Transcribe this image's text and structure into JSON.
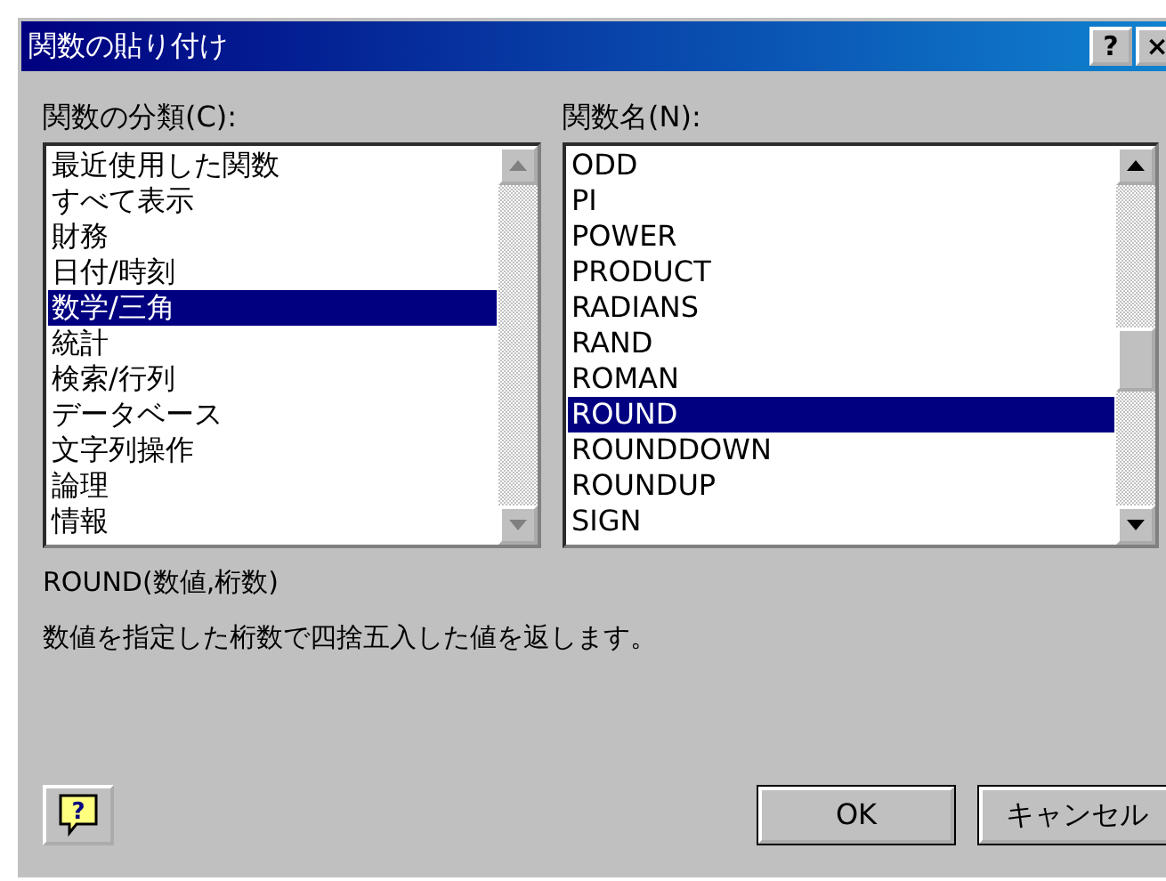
{
  "window": {
    "title": "関数の貼り付け",
    "title_buttons": [
      "?",
      "×"
    ]
  },
  "category_list": {
    "label": "関数の分類(C):",
    "items": [
      {
        "text": "最近使用した関数",
        "selected": false
      },
      {
        "text": "すべて表示",
        "selected": false
      },
      {
        "text": "財務",
        "selected": false
      },
      {
        "text": "日付/時刻",
        "selected": false
      },
      {
        "text": "数学/三角",
        "selected": true
      },
      {
        "text": "統計",
        "selected": false
      },
      {
        "text": "検索/行列",
        "selected": false
      },
      {
        "text": "データベース",
        "selected": false
      },
      {
        "text": "文字列操作",
        "selected": false
      },
      {
        "text": "論理",
        "selected": false
      },
      {
        "text": "情報",
        "selected": false
      }
    ],
    "scrollbar_disabled": true
  },
  "function_list": {
    "label": "関数名(N):",
    "items": [
      {
        "text": "ODD",
        "selected": false
      },
      {
        "text": "PI",
        "selected": false
      },
      {
        "text": "POWER",
        "selected": false
      },
      {
        "text": "PRODUCT",
        "selected": false
      },
      {
        "text": "RADIANS",
        "selected": false
      },
      {
        "text": "RAND",
        "selected": false
      },
      {
        "text": "ROMAN",
        "selected": false
      },
      {
        "text": "ROUND",
        "selected": true
      },
      {
        "text": "ROUNDDOWN",
        "selected": false
      },
      {
        "text": "ROUNDUP",
        "selected": false
      },
      {
        "text": "SIGN",
        "selected": false
      }
    ],
    "scrollbar_disabled": false
  },
  "syntax": "ROUND(数値,桁数)",
  "description": "数値を指定した桁数で四捨五入した値を返します。",
  "help_button": "?",
  "buttons": [
    "OK",
    "キャンセル"
  ]
}
